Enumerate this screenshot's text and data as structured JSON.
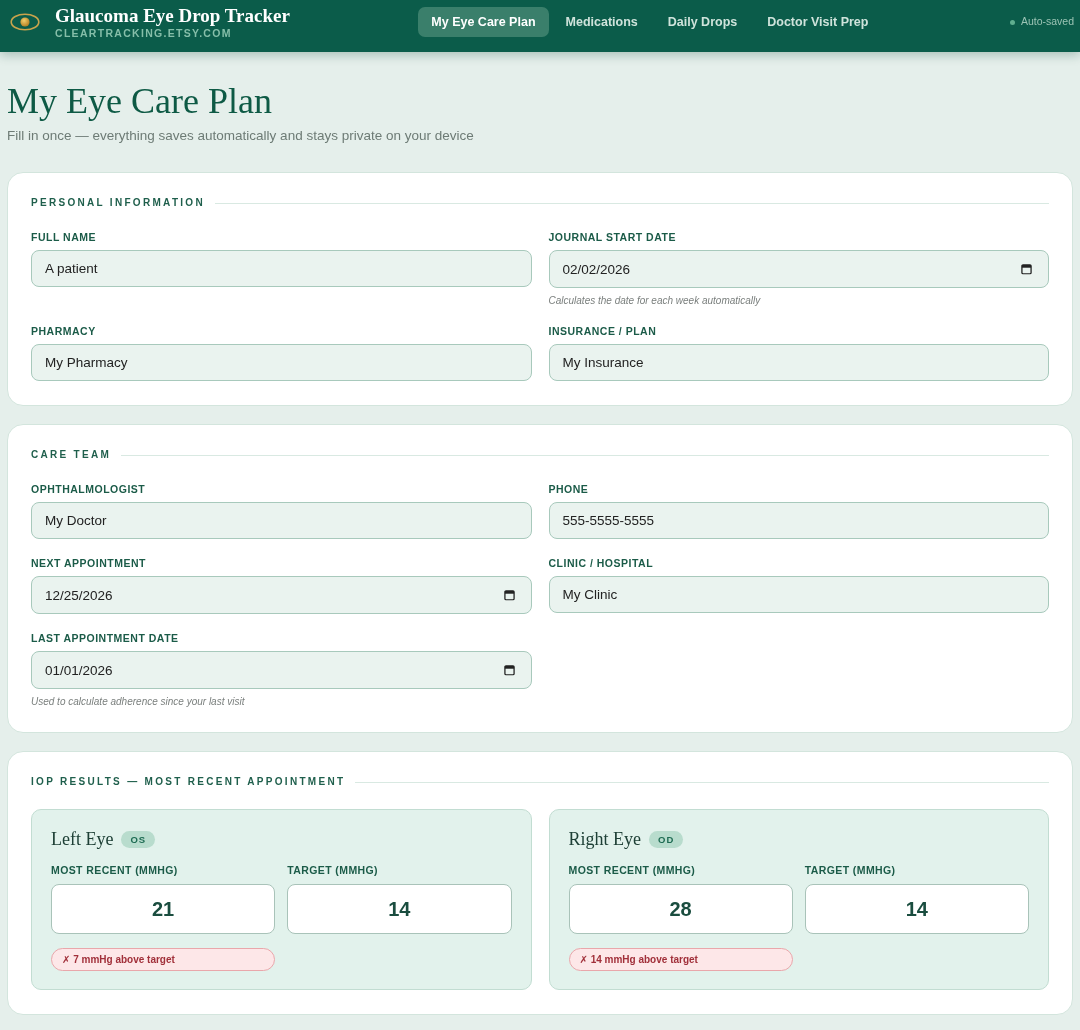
{
  "header": {
    "title": "Glaucoma Eye Drop Tracker",
    "subtitle": "CLEARTRACKING.ETSY.COM",
    "tabs": [
      {
        "label": "My Eye Care Plan",
        "selected": true
      },
      {
        "label": "Medications",
        "selected": false
      },
      {
        "label": "Daily Drops",
        "selected": false
      },
      {
        "label": "Doctor Visit Prep",
        "selected": false
      }
    ],
    "status": "Auto-saved"
  },
  "page": {
    "title": "My Eye Care Plan",
    "subtitle": "Fill in once — everything saves automatically and stays private on your device"
  },
  "sections": [
    {
      "kind": "form",
      "title": "PERSONAL INFORMATION",
      "fields": [
        {
          "kind": "text",
          "label": "FULL NAME",
          "value": "A patient"
        },
        {
          "kind": "date",
          "label": "JOURNAL START DATE",
          "value": "02/02/2026",
          "hint": "Calculates the date for each week automatically"
        },
        {
          "kind": "text",
          "label": "PHARMACY",
          "value": "My Pharmacy"
        },
        {
          "kind": "text",
          "label": "INSURANCE / PLAN",
          "value": "My Insurance"
        }
      ]
    },
    {
      "kind": "form",
      "title": "CARE TEAM",
      "fields": [
        {
          "kind": "text",
          "label": "OPHTHALMOLOGIST",
          "value": "My Doctor"
        },
        {
          "kind": "text",
          "label": "PHONE",
          "value": "555-5555-5555"
        },
        {
          "kind": "date",
          "label": "NEXT APPOINTMENT",
          "value": "12/25/2026"
        },
        {
          "kind": "text",
          "label": "CLINIC / HOSPITAL",
          "value": "My Clinic"
        },
        {
          "kind": "date",
          "label": "LAST APPOINTMENT DATE",
          "value": "01/01/2026",
          "hint": "Used to calculate adherence since your last visit"
        }
      ]
    },
    {
      "kind": "iop",
      "title": "IOP RESULTS — MOST RECENT APPOINTMENT",
      "eyes": [
        {
          "name": "Left Eye",
          "code": "OS",
          "readings": [
            {
              "label": "MOST RECENT (MMHG)",
              "value": "21"
            },
            {
              "label": "TARGET (MMHG)",
              "value": "14"
            }
          ],
          "alert": {
            "kind": "warning",
            "text": "✗ 7 mmHg above target"
          }
        },
        {
          "name": "Right Eye",
          "code": "OD",
          "readings": [
            {
              "label": "MOST RECENT (MMHG)",
              "value": "28"
            },
            {
              "label": "TARGET (MMHG)",
              "value": "14"
            }
          ],
          "alert": {
            "kind": "warning",
            "text": "✗ 14 mmHg above target"
          }
        }
      ]
    }
  ]
}
